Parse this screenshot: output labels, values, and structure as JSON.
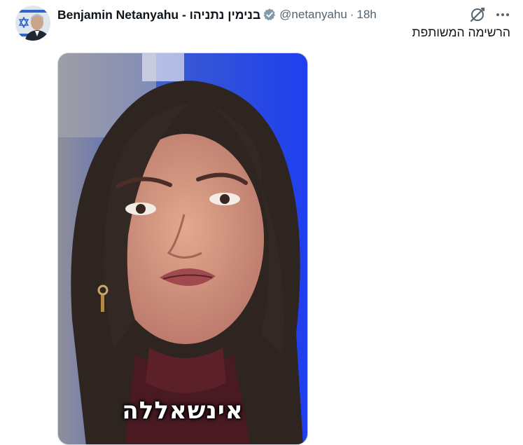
{
  "tweet": {
    "author": {
      "display_name": "Benjamin Netanyahu - בנימין נתניהו",
      "handle": "@netanyahu",
      "verified": true,
      "verified_badge_color": "#829aab",
      "avatar_icon": "profile-photo-with-israeli-flag"
    },
    "separator": "·",
    "timestamp": "18h",
    "text": "הרשימה המשותפת",
    "actions": {
      "grok_icon": "grok-icon",
      "more_icon": "more-icon"
    },
    "media": {
      "type": "video",
      "caption": "אינשאללה"
    }
  }
}
